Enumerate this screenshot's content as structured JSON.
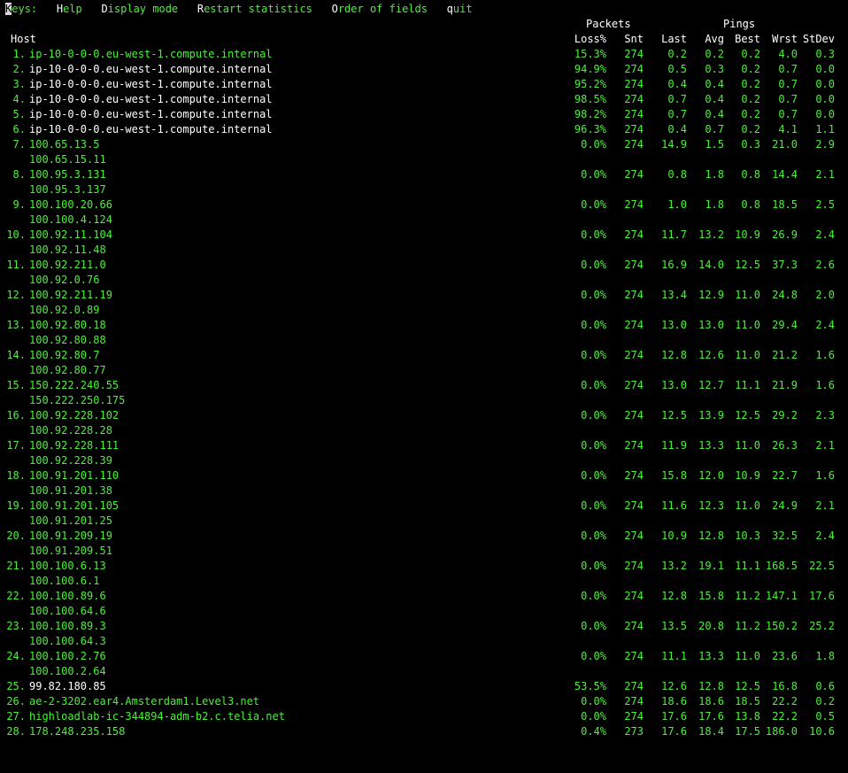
{
  "menu": {
    "keys_first": "K",
    "keys_rest": "eys:",
    "items": [
      {
        "key": "H",
        "rest": "elp"
      },
      {
        "key": "D",
        "rest": "isplay mode"
      },
      {
        "key": "R",
        "rest": "estart statistics"
      },
      {
        "key": "O",
        "rest": "rder of fields"
      },
      {
        "key": "q",
        "rest": "uit"
      }
    ]
  },
  "header": {
    "packets_group": "Packets",
    "pings_group": "Pings",
    "host": "Host",
    "loss": "Loss%",
    "snt": "Snt",
    "last": "Last",
    "avg": "Avg",
    "best": "Best",
    "wrst": "Wrst",
    "stdev": "StDev"
  },
  "colors": {
    "background": "#000000",
    "text_green": "#4cf03a",
    "text_white": "#ffffff",
    "cursor": "#d9d9d9"
  },
  "hops": [
    {
      "n": "1.",
      "host": "ip-10-0-0-0.eu-west-1.compute.internal",
      "alt": "",
      "loss": "15.3%",
      "snt": "274",
      "last": "0.2",
      "avg": "0.2",
      "best": "0.2",
      "wrst": "4.0",
      "stdev": "0.3",
      "white": false
    },
    {
      "n": "2.",
      "host": "ip-10-0-0-0.eu-west-1.compute.internal",
      "alt": "",
      "loss": "94.9%",
      "snt": "274",
      "last": "0.5",
      "avg": "0.3",
      "best": "0.2",
      "wrst": "0.7",
      "stdev": "0.0",
      "white": true
    },
    {
      "n": "3.",
      "host": "ip-10-0-0-0.eu-west-1.compute.internal",
      "alt": "",
      "loss": "95.2%",
      "snt": "274",
      "last": "0.4",
      "avg": "0.4",
      "best": "0.2",
      "wrst": "0.7",
      "stdev": "0.0",
      "white": true
    },
    {
      "n": "4.",
      "host": "ip-10-0-0-0.eu-west-1.compute.internal",
      "alt": "",
      "loss": "98.5%",
      "snt": "274",
      "last": "0.7",
      "avg": "0.4",
      "best": "0.2",
      "wrst": "0.7",
      "stdev": "0.0",
      "white": true
    },
    {
      "n": "5.",
      "host": "ip-10-0-0-0.eu-west-1.compute.internal",
      "alt": "",
      "loss": "98.2%",
      "snt": "274",
      "last": "0.7",
      "avg": "0.4",
      "best": "0.2",
      "wrst": "0.7",
      "stdev": "0.0",
      "white": true
    },
    {
      "n": "6.",
      "host": "ip-10-0-0-0.eu-west-1.compute.internal",
      "alt": "",
      "loss": "96.3%",
      "snt": "274",
      "last": "0.4",
      "avg": "0.7",
      "best": "0.2",
      "wrst": "4.1",
      "stdev": "1.1",
      "white": true
    },
    {
      "n": "7.",
      "host": "100.65.13.5",
      "alt": "100.65.15.11",
      "loss": "0.0%",
      "snt": "274",
      "last": "14.9",
      "avg": "1.5",
      "best": "0.3",
      "wrst": "21.0",
      "stdev": "2.9",
      "white": false
    },
    {
      "n": "8.",
      "host": "100.95.3.131",
      "alt": "100.95.3.137",
      "loss": "0.0%",
      "snt": "274",
      "last": "0.8",
      "avg": "1.8",
      "best": "0.8",
      "wrst": "14.4",
      "stdev": "2.1",
      "white": false
    },
    {
      "n": "9.",
      "host": "100.100.20.66",
      "alt": "100.100.4.124",
      "loss": "0.0%",
      "snt": "274",
      "last": "1.0",
      "avg": "1.8",
      "best": "0.8",
      "wrst": "18.5",
      "stdev": "2.5",
      "white": false
    },
    {
      "n": "10.",
      "host": "100.92.11.104",
      "alt": "100.92.11.48",
      "loss": "0.0%",
      "snt": "274",
      "last": "11.7",
      "avg": "13.2",
      "best": "10.9",
      "wrst": "26.9",
      "stdev": "2.4",
      "white": false
    },
    {
      "n": "11.",
      "host": "100.92.211.0",
      "alt": "100.92.0.76",
      "loss": "0.0%",
      "snt": "274",
      "last": "16.9",
      "avg": "14.0",
      "best": "12.5",
      "wrst": "37.3",
      "stdev": "2.6",
      "white": false
    },
    {
      "n": "12.",
      "host": "100.92.211.19",
      "alt": "100.92.0.89",
      "loss": "0.0%",
      "snt": "274",
      "last": "13.4",
      "avg": "12.9",
      "best": "11.0",
      "wrst": "24.8",
      "stdev": "2.0",
      "white": false
    },
    {
      "n": "13.",
      "host": "100.92.80.18",
      "alt": "100.92.80.88",
      "loss": "0.0%",
      "snt": "274",
      "last": "13.0",
      "avg": "13.0",
      "best": "11.0",
      "wrst": "29.4",
      "stdev": "2.4",
      "white": false
    },
    {
      "n": "14.",
      "host": "100.92.80.7",
      "alt": "100.92.80.77",
      "loss": "0.0%",
      "snt": "274",
      "last": "12.8",
      "avg": "12.6",
      "best": "11.0",
      "wrst": "21.2",
      "stdev": "1.6",
      "white": false
    },
    {
      "n": "15.",
      "host": "150.222.240.55",
      "alt": "150.222.250.175",
      "loss": "0.0%",
      "snt": "274",
      "last": "13.0",
      "avg": "12.7",
      "best": "11.1",
      "wrst": "21.9",
      "stdev": "1.6",
      "white": false
    },
    {
      "n": "16.",
      "host": "100.92.228.102",
      "alt": "100.92.228.28",
      "loss": "0.0%",
      "snt": "274",
      "last": "12.5",
      "avg": "13.9",
      "best": "12.5",
      "wrst": "29.2",
      "stdev": "2.3",
      "white": false
    },
    {
      "n": "17.",
      "host": "100.92.228.111",
      "alt": "100.92.228.39",
      "loss": "0.0%",
      "snt": "274",
      "last": "11.9",
      "avg": "13.3",
      "best": "11.0",
      "wrst": "26.3",
      "stdev": "2.1",
      "white": false
    },
    {
      "n": "18.",
      "host": "100.91.201.110",
      "alt": "100.91.201.38",
      "loss": "0.0%",
      "snt": "274",
      "last": "15.8",
      "avg": "12.0",
      "best": "10.9",
      "wrst": "22.7",
      "stdev": "1.6",
      "white": false
    },
    {
      "n": "19.",
      "host": "100.91.201.105",
      "alt": "100.91.201.25",
      "loss": "0.0%",
      "snt": "274",
      "last": "11.6",
      "avg": "12.3",
      "best": "11.0",
      "wrst": "24.9",
      "stdev": "2.1",
      "white": false
    },
    {
      "n": "20.",
      "host": "100.91.209.19",
      "alt": "100.91.209.51",
      "loss": "0.0%",
      "snt": "274",
      "last": "10.9",
      "avg": "12.8",
      "best": "10.3",
      "wrst": "32.5",
      "stdev": "2.4",
      "white": false
    },
    {
      "n": "21.",
      "host": "100.100.6.13",
      "alt": "100.100.6.1",
      "loss": "0.0%",
      "snt": "274",
      "last": "13.2",
      "avg": "19.1",
      "best": "11.1",
      "wrst": "168.5",
      "stdev": "22.5",
      "white": false
    },
    {
      "n": "22.",
      "host": "100.100.89.6",
      "alt": "100.100.64.6",
      "loss": "0.0%",
      "snt": "274",
      "last": "12.8",
      "avg": "15.8",
      "best": "11.2",
      "wrst": "147.1",
      "stdev": "17.6",
      "white": false
    },
    {
      "n": "23.",
      "host": "100.100.89.3",
      "alt": "100.100.64.3",
      "loss": "0.0%",
      "snt": "274",
      "last": "13.5",
      "avg": "20.8",
      "best": "11.2",
      "wrst": "150.2",
      "stdev": "25.2",
      "white": false
    },
    {
      "n": "24.",
      "host": "100.100.2.76",
      "alt": "100.100.2.64",
      "loss": "0.0%",
      "snt": "274",
      "last": "11.1",
      "avg": "13.3",
      "best": "11.0",
      "wrst": "23.6",
      "stdev": "1.8",
      "white": false
    },
    {
      "n": "25.",
      "host": "99.82.180.85",
      "alt": "",
      "loss": "53.5%",
      "snt": "274",
      "last": "12.6",
      "avg": "12.8",
      "best": "12.5",
      "wrst": "16.8",
      "stdev": "0.6",
      "white": true
    },
    {
      "n": "26.",
      "host": "ae-2-3202.ear4.Amsterdam1.Level3.net",
      "alt": "",
      "loss": "0.0%",
      "snt": "274",
      "last": "18.6",
      "avg": "18.6",
      "best": "18.5",
      "wrst": "22.2",
      "stdev": "0.2",
      "white": false
    },
    {
      "n": "27.",
      "host": "highloadlab-ic-344894-adm-b2.c.telia.net",
      "alt": "",
      "loss": "0.0%",
      "snt": "274",
      "last": "17.6",
      "avg": "17.6",
      "best": "13.8",
      "wrst": "22.2",
      "stdev": "0.5",
      "white": false
    },
    {
      "n": "28.",
      "host": "178.248.235.158",
      "alt": "",
      "loss": "0.4%",
      "snt": "273",
      "last": "17.6",
      "avg": "18.4",
      "best": "17.5",
      "wrst": "186.0",
      "stdev": "10.6",
      "white": false
    }
  ]
}
